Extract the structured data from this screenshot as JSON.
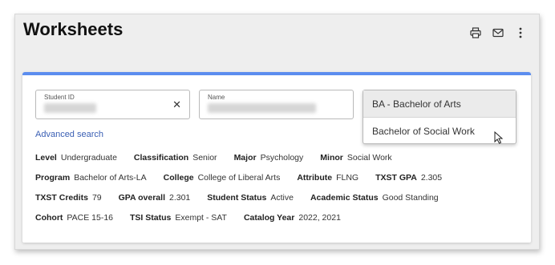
{
  "header": {
    "title": "Worksheets",
    "icons": [
      "printer-icon",
      "mail-icon",
      "more-vertical-icon"
    ]
  },
  "search": {
    "student_id_label": "Student ID",
    "name_label": "Name",
    "clear_symbol": "✕",
    "advanced_search": "Advanced search"
  },
  "dropdown": {
    "options": [
      {
        "label": "BA - Bachelor of Arts",
        "selected": true
      },
      {
        "label": "Bachelor of Social Work",
        "selected": false
      }
    ]
  },
  "info_rows": [
    [
      {
        "label": "Level",
        "value": "Undergraduate"
      },
      {
        "label": "Classification",
        "value": "Senior"
      },
      {
        "label": "Major",
        "value": "Psychology"
      },
      {
        "label": "Minor",
        "value": "Social Work"
      }
    ],
    [
      {
        "label": "Program",
        "value": "Bachelor of Arts-LA"
      },
      {
        "label": "College",
        "value": "College of Liberal Arts"
      },
      {
        "label": "Attribute",
        "value": "FLNG"
      },
      {
        "label": "TXST GPA",
        "value": "2.305"
      }
    ],
    [
      {
        "label": "TXST Credits",
        "value": "79"
      },
      {
        "label": "GPA overall",
        "value": "2.301"
      },
      {
        "label": "Student Status",
        "value": "Active"
      },
      {
        "label": "Academic Status",
        "value": "Good Standing"
      }
    ],
    [
      {
        "label": "Cohort",
        "value": "PACE 15-16"
      },
      {
        "label": "TSI Status",
        "value": "Exempt - SAT"
      },
      {
        "label": "Catalog Year",
        "value": "2022, 2021"
      }
    ]
  ],
  "colors": {
    "accent_bar": "#5b8def",
    "link": "#3a5fb4",
    "background": "#eeeeee"
  }
}
